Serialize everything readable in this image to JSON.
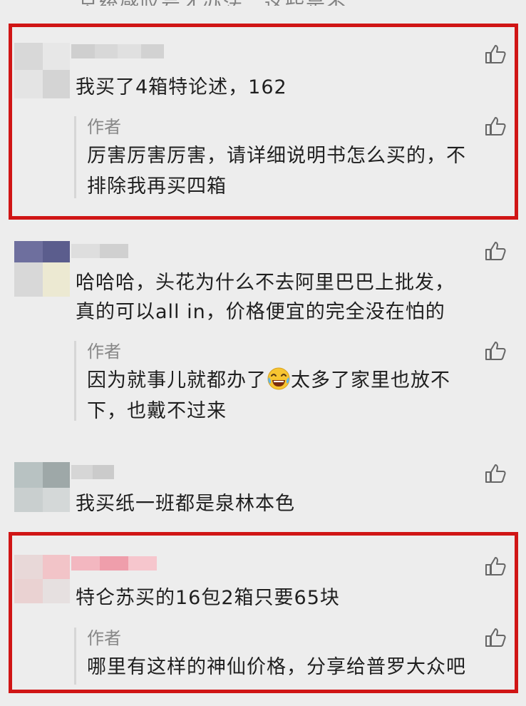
{
  "cutoff_text": "总统感叹号才办法，这些是不",
  "reply_label": "作者",
  "comments": [
    {
      "text": "我买了4箱特论述，162",
      "reply": [
        "厉害厉害厉害，请详细说明书怎么买的，不",
        "排除我再买四箱"
      ]
    },
    {
      "text_lines": [
        "哈哈哈，头花为什么不去阿里巴巴上批发，",
        "真的可以all in，价格便宜的完全没在怕的"
      ],
      "reply_a": "因为就事儿就都办了",
      "reply_emoji": "laughing-crying-emoji",
      "reply_b": "太多了家里也放不",
      "reply_c": "下，也戴不过来"
    },
    {
      "text": "我买纸一班都是泉林本色"
    },
    {
      "text": "特仑苏买的16包2箱只要65块",
      "reply": [
        "哪里有这样的神仙价格，分享给普罗大众吧"
      ]
    }
  ],
  "icons": {
    "like": "thumbs-up-icon"
  },
  "colors": {
    "highlight": "#d01515",
    "background": "#ededed",
    "reply_label": "#888888"
  }
}
